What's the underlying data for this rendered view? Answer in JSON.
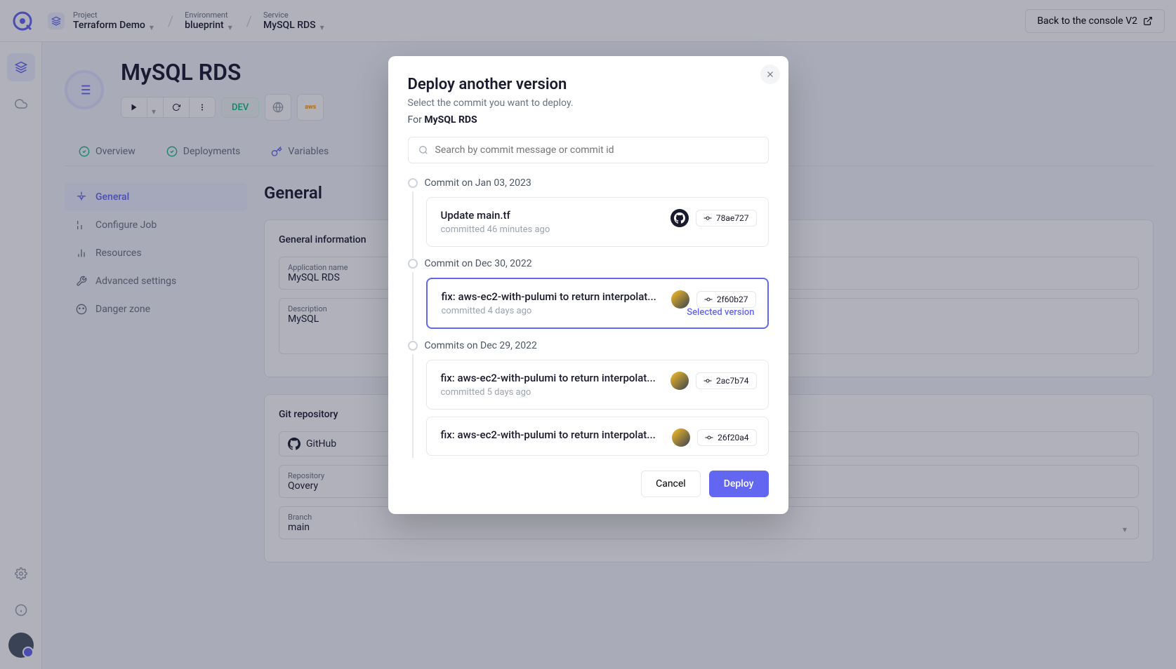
{
  "topbar": {
    "project_label": "Project",
    "project_value": "Terraform Demo",
    "env_label": "Environment",
    "env_value": "blueprint",
    "service_label": "Service",
    "service_value": "MySQL RDS",
    "back_btn": "Back to the console V2"
  },
  "service": {
    "title": "MySQL RDS",
    "dev_badge": "DEV"
  },
  "tabs": {
    "overview": "Overview",
    "deployments": "Deployments",
    "variables": "Variables"
  },
  "sidebar": {
    "general": "General",
    "configure": "Configure Job",
    "resources": "Resources",
    "advanced": "Advanced settings",
    "danger": "Danger zone"
  },
  "content": {
    "page_title": "General",
    "card1_title": "General information",
    "app_label": "Application name",
    "app_value": "MySQL RDS",
    "desc_label": "Description",
    "desc_value": "MySQL",
    "card2_title": "Git repository",
    "repo_label": "Repository",
    "repo_value": "Qovery",
    "branch_label": "Branch",
    "branch_value": "main"
  },
  "modal": {
    "title": "Deploy another version",
    "subtitle": "Select the commit you want to deploy.",
    "for_prefix": "For",
    "for_service": "MySQL RDS",
    "search_placeholder": "Search by commit message or commit id",
    "selected_label": "Selected version",
    "cancel": "Cancel",
    "deploy": "Deploy",
    "groups": [
      {
        "date": "Commit on Jan 03, 2023",
        "commits": [
          {
            "title": "Update main.tf",
            "time": "committed 46 minutes ago",
            "hash": "78ae727",
            "avatar": "github",
            "selected": false
          }
        ]
      },
      {
        "date": "Commit on Dec 30, 2022",
        "commits": [
          {
            "title": "fix: aws-ec2-with-pulumi to return interpolat...",
            "time": "committed 4 days ago",
            "hash": "2f60b27",
            "avatar": "user",
            "selected": true
          }
        ]
      },
      {
        "date": "Commits on Dec 29, 2022",
        "commits": [
          {
            "title": "fix: aws-ec2-with-pulumi to return interpolat...",
            "time": "committed 5 days ago",
            "hash": "2ac7b74",
            "avatar": "user",
            "selected": false
          },
          {
            "title": "fix: aws-ec2-with-pulumi to return interpolat...",
            "time": "",
            "hash": "26f20a4",
            "avatar": "user",
            "selected": false
          }
        ]
      }
    ]
  }
}
